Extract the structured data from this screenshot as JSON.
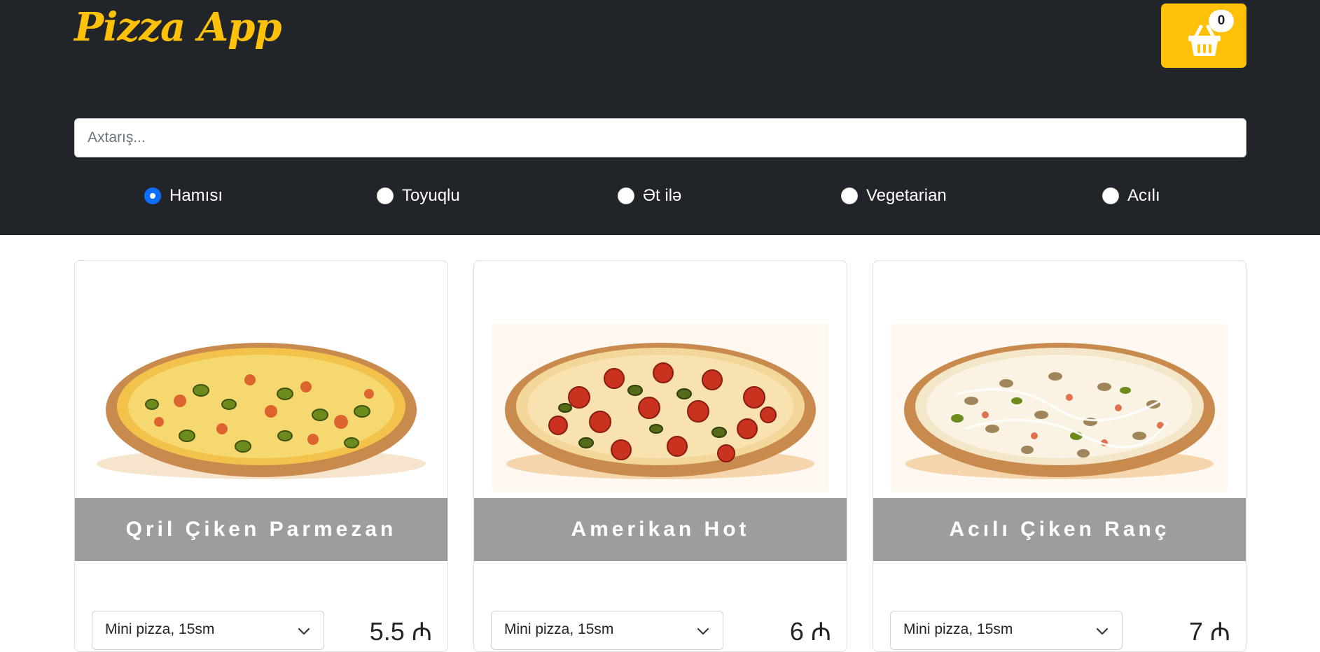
{
  "app": {
    "brand": "Pizza App",
    "cart_count": "0",
    "colors": {
      "accent": "#ffc107",
      "header_bg": "#212529",
      "radio_checked": "#0d6efd"
    }
  },
  "search": {
    "placeholder": "Axtarış...",
    "value": ""
  },
  "filters": [
    {
      "label": "Hamısı",
      "checked": true
    },
    {
      "label": "Toyuqlu",
      "checked": false
    },
    {
      "label": "Ət ilə",
      "checked": false
    },
    {
      "label": "Vegetarian",
      "checked": false
    },
    {
      "label": "Acılı",
      "checked": false
    }
  ],
  "products": [
    {
      "name": "Qril Çiken Parmezan",
      "size": "Mini pizza, 15sm",
      "price": "5.5 ₼",
      "image": "pizza-jalapeno-icon"
    },
    {
      "name": "Amerikan Hot",
      "size": "Mini pizza, 15sm",
      "price": "6 ₼",
      "image": "pizza-pepperoni-icon"
    },
    {
      "name": "Acılı Çiken Ranç",
      "size": "Mini pizza, 15sm",
      "price": "7 ₼",
      "image": "pizza-ranch-icon"
    }
  ]
}
